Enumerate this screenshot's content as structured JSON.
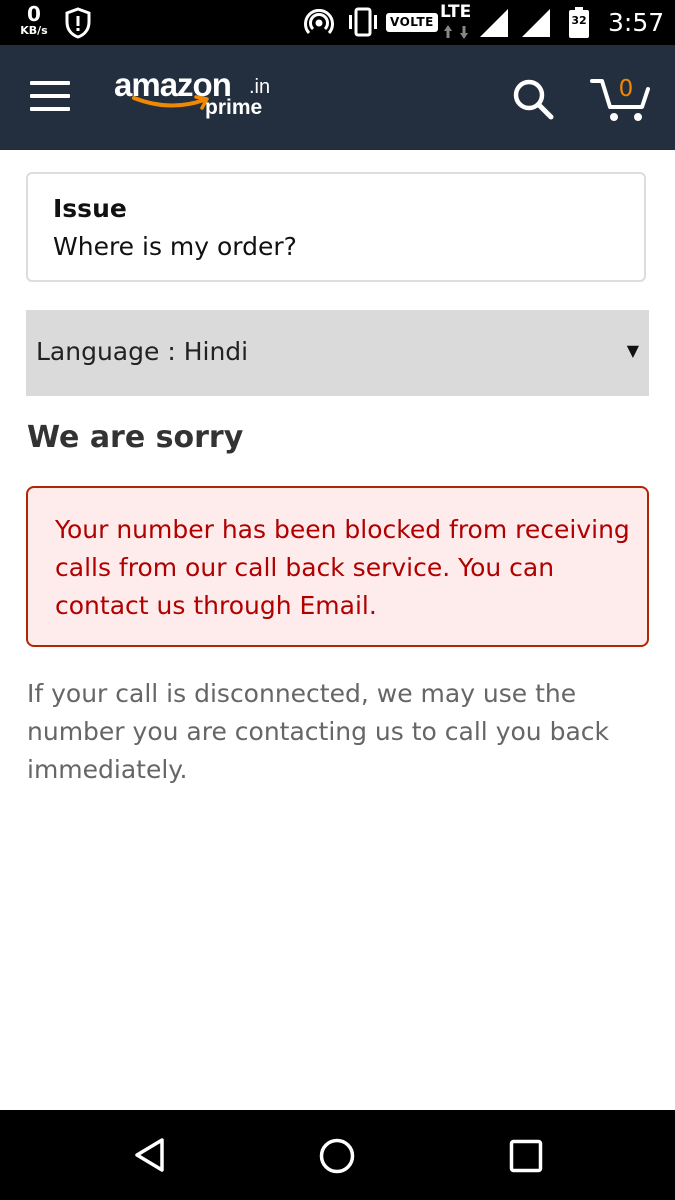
{
  "status_bar": {
    "net_speed_value": "0",
    "net_speed_unit": "KB/s",
    "volte": "VOLTE",
    "network": "LTE",
    "battery_level": "32",
    "time": "3:57",
    "icons": [
      "shield-icon",
      "hotspot-icon",
      "vibrate-icon",
      "lte-arrows-icon",
      "signal-icon",
      "signal-icon",
      "battery-icon"
    ]
  },
  "header": {
    "logo_word": "amazon",
    "logo_suffix": ".in",
    "logo_sub": "prime",
    "cart_count": "0",
    "icons": [
      "menu-icon",
      "search-icon",
      "cart-icon"
    ],
    "colors": {
      "background": "#232f3e",
      "accent": "#f08804"
    }
  },
  "issue": {
    "title": "Issue",
    "value": "Where is my order?"
  },
  "language_select": {
    "selected": "Language : Hindi"
  },
  "sorry_heading": "We are sorry",
  "error_message": "Your number has been blocked from receiving calls from our call back service. You can contact us through Email.",
  "info_message": "If your call is disconnected, we may use the number you are contacting us to call you back immediately.",
  "colors": {
    "error_text": "#b00000",
    "error_border": "#b12704",
    "error_bg": "#fdeceb"
  },
  "nav_bar": {
    "icons": [
      "back-icon",
      "home-icon",
      "recents-icon"
    ]
  }
}
